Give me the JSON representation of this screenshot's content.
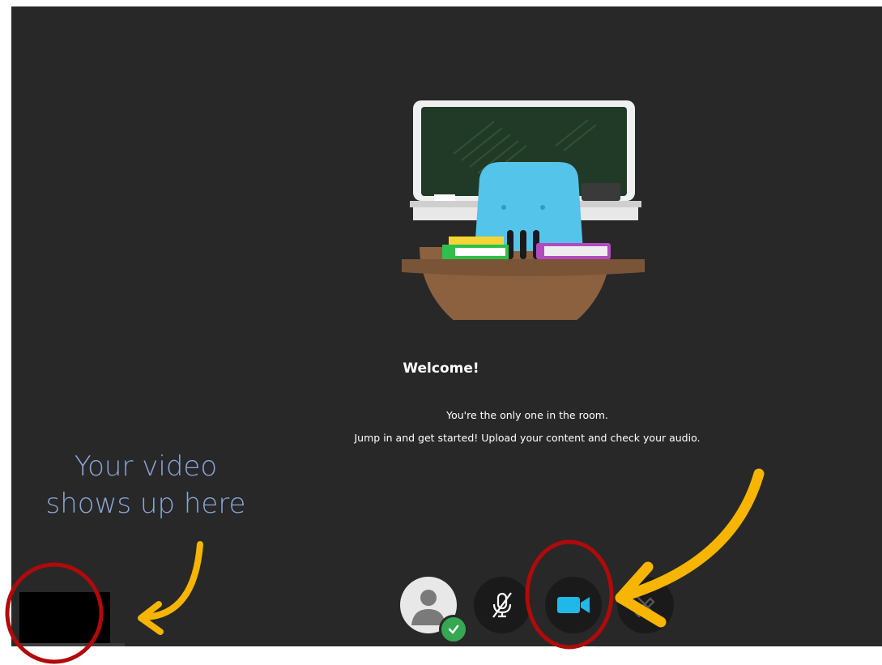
{
  "welcome": {
    "title": "Welcome!",
    "line1": "You're the only one in the room.",
    "line2": "Jump in and get started! Upload your content and check your audio."
  },
  "callout": {
    "line1": "Your video",
    "line2": "shows up here"
  },
  "controls": {
    "status_icon": "avatar-status-icon",
    "mic_icon": "microphone-muted-icon",
    "camera_icon": "video-camera-icon",
    "share_icon": "share-content-icon"
  },
  "colors": {
    "stage_bg": "#282828",
    "camera_accent": "#20b8e8",
    "annotation_circle": "#b00a0a",
    "annotation_arrow": "#f7b500",
    "callout_text": "#8aa6d6"
  }
}
